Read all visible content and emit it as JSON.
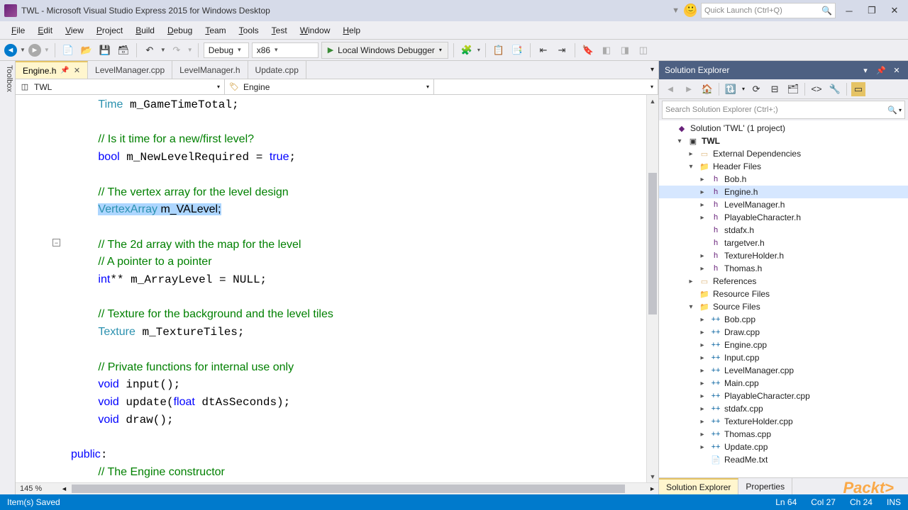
{
  "window": {
    "title": "TWL - Microsoft Visual Studio Express 2015 for Windows Desktop",
    "quick_launch_placeholder": "Quick Launch (Ctrl+Q)"
  },
  "menu": [
    "File",
    "Edit",
    "View",
    "Project",
    "Build",
    "Debug",
    "Team",
    "Tools",
    "Test",
    "Window",
    "Help"
  ],
  "toolbar": {
    "config": "Debug",
    "platform": "x86",
    "debugger_label": "Local Windows Debugger"
  },
  "tabs": [
    {
      "label": "Engine.h",
      "active": true,
      "close": true
    },
    {
      "label": "LevelManager.cpp",
      "active": false,
      "close": false
    },
    {
      "label": "LevelManager.h",
      "active": false,
      "close": false
    },
    {
      "label": "Update.cpp",
      "active": false,
      "close": false
    }
  ],
  "navbar": {
    "scope": "TWL",
    "class": "Engine",
    "member": ""
  },
  "code_lines": [
    {
      "indent": 1,
      "tokens": [
        {
          "t": "Time",
          "c": "kw-type"
        },
        {
          "t": " m_GameTimeTotal;"
        }
      ]
    },
    {
      "indent": 1,
      "tokens": []
    },
    {
      "indent": 1,
      "tokens": [
        {
          "t": "// Is it time for a new/first level?",
          "c": "comment"
        }
      ]
    },
    {
      "indent": 1,
      "tokens": [
        {
          "t": "bool",
          "c": "kw"
        },
        {
          "t": " m_NewLevelRequired = "
        },
        {
          "t": "true",
          "c": "kw"
        },
        {
          "t": ";"
        }
      ]
    },
    {
      "indent": 1,
      "tokens": []
    },
    {
      "indent": 1,
      "tokens": [
        {
          "t": "// The vertex array for the level design",
          "c": "comment"
        }
      ]
    },
    {
      "indent": 1,
      "tokens": [
        {
          "t": "VertexArray",
          "c": "kw-type",
          "sel": true
        },
        {
          "t": " m_VALevel;",
          "sel": true
        }
      ]
    },
    {
      "indent": 1,
      "tokens": []
    },
    {
      "indent": 1,
      "tokens": [
        {
          "t": "// The 2d array with the map for the level",
          "c": "comment"
        }
      ]
    },
    {
      "indent": 1,
      "tokens": [
        {
          "t": "// A pointer to a pointer",
          "c": "comment"
        }
      ]
    },
    {
      "indent": 1,
      "tokens": [
        {
          "t": "int",
          "c": "kw"
        },
        {
          "t": "** m_ArrayLevel = NULL;"
        }
      ]
    },
    {
      "indent": 1,
      "tokens": []
    },
    {
      "indent": 1,
      "tokens": [
        {
          "t": "// Texture for the background and the level tiles",
          "c": "comment"
        }
      ]
    },
    {
      "indent": 1,
      "tokens": [
        {
          "t": "Texture",
          "c": "kw-type"
        },
        {
          "t": " m_TextureTiles;"
        }
      ]
    },
    {
      "indent": 1,
      "tokens": []
    },
    {
      "indent": 1,
      "tokens": [
        {
          "t": "// Private functions for internal use only",
          "c": "comment"
        }
      ]
    },
    {
      "indent": 1,
      "tokens": [
        {
          "t": "void",
          "c": "kw"
        },
        {
          "t": " input();"
        }
      ]
    },
    {
      "indent": 1,
      "tokens": [
        {
          "t": "void",
          "c": "kw"
        },
        {
          "t": " update("
        },
        {
          "t": "float",
          "c": "kw"
        },
        {
          "t": " dtAsSeconds);"
        }
      ]
    },
    {
      "indent": 1,
      "tokens": [
        {
          "t": "void",
          "c": "kw"
        },
        {
          "t": " draw();"
        }
      ]
    },
    {
      "indent": 1,
      "tokens": []
    },
    {
      "indent": 0,
      "tokens": [
        {
          "t": "public",
          "c": "kw"
        },
        {
          "t": ":"
        }
      ]
    },
    {
      "indent": 1,
      "tokens": [
        {
          "t": "// The Engine constructor",
          "c": "comment"
        }
      ]
    }
  ],
  "zoom": "145 %",
  "solution_explorer": {
    "title": "Solution Explorer",
    "search_placeholder": "Search Solution Explorer (Ctrl+;)",
    "solution_label": "Solution 'TWL' (1 project)",
    "project": "TWL",
    "nodes": [
      {
        "depth": 0,
        "icon": "sol",
        "label": "Solution 'TWL' (1 project)",
        "exp": ""
      },
      {
        "depth": 1,
        "icon": "proj",
        "label": "TWL",
        "exp": "▾",
        "bold": true
      },
      {
        "depth": 2,
        "icon": "ref",
        "label": "External Dependencies",
        "exp": "▸"
      },
      {
        "depth": 2,
        "icon": "fold",
        "label": "Header Files",
        "exp": "▾"
      },
      {
        "depth": 3,
        "icon": "h",
        "label": "Bob.h",
        "exp": "▸"
      },
      {
        "depth": 3,
        "icon": "h",
        "label": "Engine.h",
        "exp": "▸",
        "sel": true
      },
      {
        "depth": 3,
        "icon": "h",
        "label": "LevelManager.h",
        "exp": "▸"
      },
      {
        "depth": 3,
        "icon": "h",
        "label": "PlayableCharacter.h",
        "exp": "▸"
      },
      {
        "depth": 3,
        "icon": "h",
        "label": "stdafx.h",
        "exp": ""
      },
      {
        "depth": 3,
        "icon": "h",
        "label": "targetver.h",
        "exp": ""
      },
      {
        "depth": 3,
        "icon": "h",
        "label": "TextureHolder.h",
        "exp": "▸"
      },
      {
        "depth": 3,
        "icon": "h",
        "label": "Thomas.h",
        "exp": "▸"
      },
      {
        "depth": 2,
        "icon": "ref",
        "label": "References",
        "exp": "▸"
      },
      {
        "depth": 2,
        "icon": "fold",
        "label": "Resource Files",
        "exp": ""
      },
      {
        "depth": 2,
        "icon": "fold",
        "label": "Source Files",
        "exp": "▾"
      },
      {
        "depth": 3,
        "icon": "cpp",
        "label": "Bob.cpp",
        "exp": "▸"
      },
      {
        "depth": 3,
        "icon": "cpp",
        "label": "Draw.cpp",
        "exp": "▸"
      },
      {
        "depth": 3,
        "icon": "cpp",
        "label": "Engine.cpp",
        "exp": "▸"
      },
      {
        "depth": 3,
        "icon": "cpp",
        "label": "Input.cpp",
        "exp": "▸"
      },
      {
        "depth": 3,
        "icon": "cpp",
        "label": "LevelManager.cpp",
        "exp": "▸"
      },
      {
        "depth": 3,
        "icon": "cpp",
        "label": "Main.cpp",
        "exp": "▸"
      },
      {
        "depth": 3,
        "icon": "cpp",
        "label": "PlayableCharacter.cpp",
        "exp": "▸"
      },
      {
        "depth": 3,
        "icon": "cpp",
        "label": "stdafx.cpp",
        "exp": "▸"
      },
      {
        "depth": 3,
        "icon": "cpp",
        "label": "TextureHolder.cpp",
        "exp": "▸"
      },
      {
        "depth": 3,
        "icon": "cpp",
        "label": "Thomas.cpp",
        "exp": "▸"
      },
      {
        "depth": 3,
        "icon": "cpp",
        "label": "Update.cpp",
        "exp": "▸"
      },
      {
        "depth": 3,
        "icon": "txt",
        "label": "ReadMe.txt",
        "exp": ""
      }
    ],
    "tabs": [
      "Solution Explorer",
      "Properties"
    ]
  },
  "status": {
    "left": "Item(s) Saved",
    "line": "Ln 64",
    "col": "Col 27",
    "ch": "Ch 24",
    "ins": "INS"
  },
  "sidebar_label": "Toolbox",
  "watermark": "Packt>"
}
